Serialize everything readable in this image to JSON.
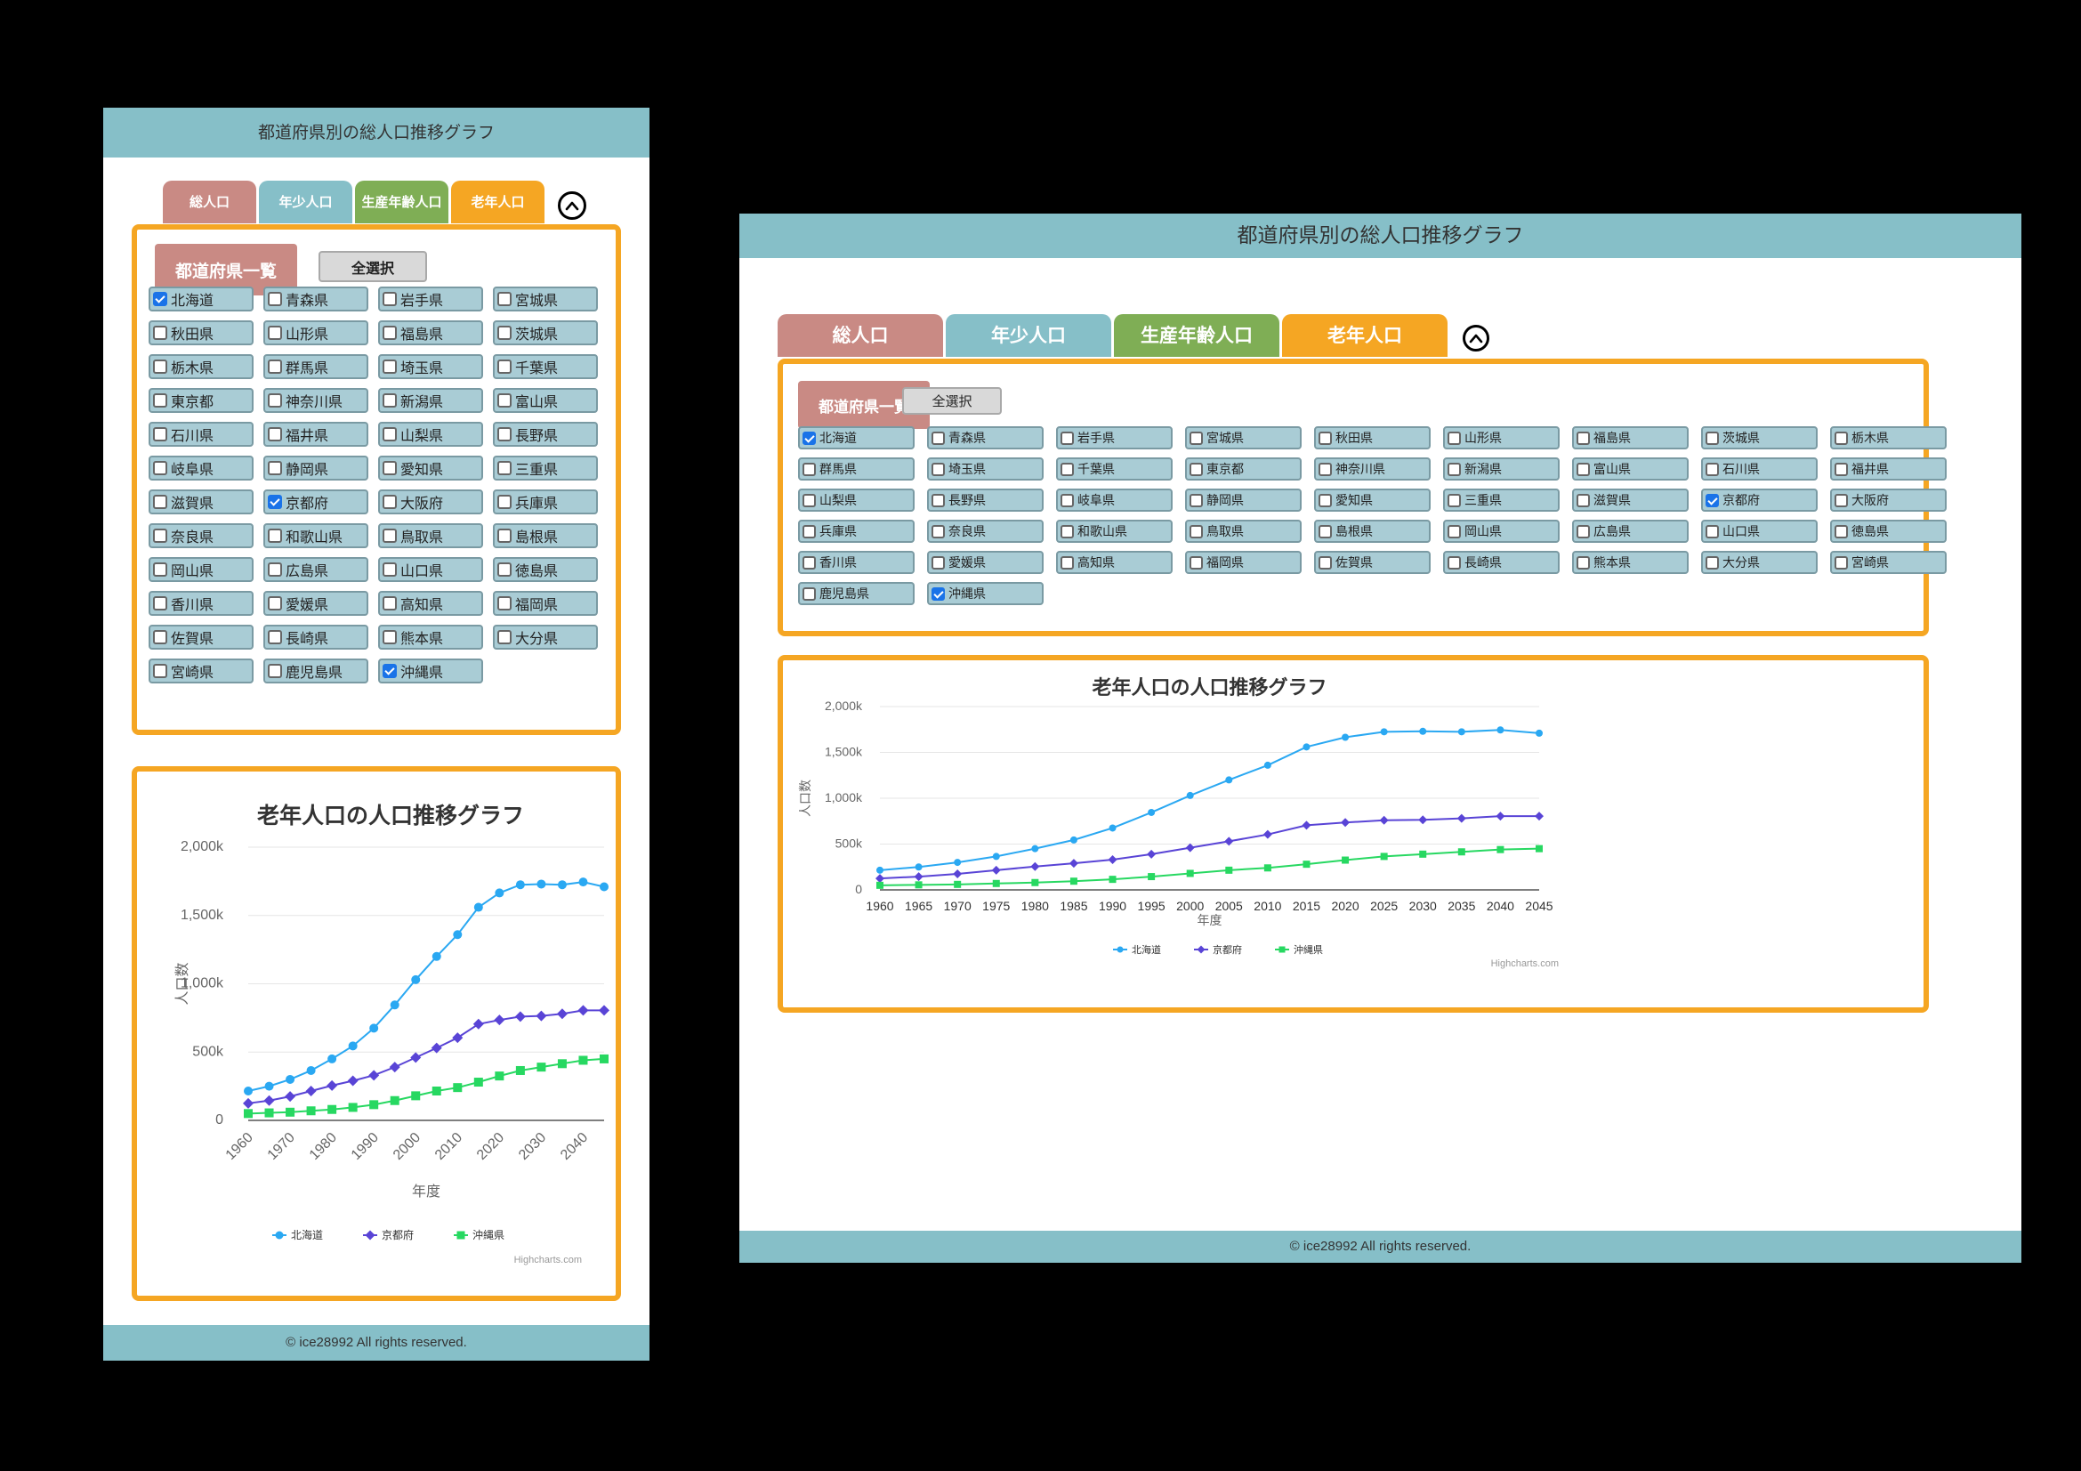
{
  "header": {
    "title": "都道府県別の総人口推移グラフ"
  },
  "tabs": [
    {
      "label": "総人口",
      "color": "#c98a84"
    },
    {
      "label": "年少人口",
      "color": "#86bfc8"
    },
    {
      "label": "生産年齢人口",
      "color": "#7fae55"
    },
    {
      "label": "老年人口",
      "color": "#f5a623"
    }
  ],
  "active_tab": "老年人口",
  "collapse_icon": "chevron-up-icon",
  "prefecture_panel": {
    "title": "都道府県一覧",
    "select_all": "全選択",
    "prefectures": [
      {
        "name": "北海道",
        "checked": true
      },
      {
        "name": "青森県",
        "checked": false
      },
      {
        "name": "岩手県",
        "checked": false
      },
      {
        "name": "宮城県",
        "checked": false
      },
      {
        "name": "秋田県",
        "checked": false
      },
      {
        "name": "山形県",
        "checked": false
      },
      {
        "name": "福島県",
        "checked": false
      },
      {
        "name": "茨城県",
        "checked": false
      },
      {
        "name": "栃木県",
        "checked": false
      },
      {
        "name": "群馬県",
        "checked": false
      },
      {
        "name": "埼玉県",
        "checked": false
      },
      {
        "name": "千葉県",
        "checked": false
      },
      {
        "name": "東京都",
        "checked": false
      },
      {
        "name": "神奈川県",
        "checked": false
      },
      {
        "name": "新潟県",
        "checked": false
      },
      {
        "name": "富山県",
        "checked": false
      },
      {
        "name": "石川県",
        "checked": false
      },
      {
        "name": "福井県",
        "checked": false
      },
      {
        "name": "山梨県",
        "checked": false
      },
      {
        "name": "長野県",
        "checked": false
      },
      {
        "name": "岐阜県",
        "checked": false
      },
      {
        "name": "静岡県",
        "checked": false
      },
      {
        "name": "愛知県",
        "checked": false
      },
      {
        "name": "三重県",
        "checked": false
      },
      {
        "name": "滋賀県",
        "checked": false
      },
      {
        "name": "京都府",
        "checked": true
      },
      {
        "name": "大阪府",
        "checked": false
      },
      {
        "name": "兵庫県",
        "checked": false
      },
      {
        "name": "奈良県",
        "checked": false
      },
      {
        "name": "和歌山県",
        "checked": false
      },
      {
        "name": "鳥取県",
        "checked": false
      },
      {
        "name": "島根県",
        "checked": false
      },
      {
        "name": "岡山県",
        "checked": false
      },
      {
        "name": "広島県",
        "checked": false
      },
      {
        "name": "山口県",
        "checked": false
      },
      {
        "name": "徳島県",
        "checked": false
      },
      {
        "name": "香川県",
        "checked": false
      },
      {
        "name": "愛媛県",
        "checked": false
      },
      {
        "name": "高知県",
        "checked": false
      },
      {
        "name": "福岡県",
        "checked": false
      },
      {
        "name": "佐賀県",
        "checked": false
      },
      {
        "name": "長崎県",
        "checked": false
      },
      {
        "name": "熊本県",
        "checked": false
      },
      {
        "name": "大分県",
        "checked": false
      },
      {
        "name": "宮崎県",
        "checked": false
      },
      {
        "name": "鹿児島県",
        "checked": false
      },
      {
        "name": "沖縄県",
        "checked": true
      }
    ]
  },
  "chart_data": {
    "type": "line",
    "title": "老年人口の人口推移グラフ",
    "xlabel": "年度",
    "ylabel": "人口数",
    "x": [
      1960,
      1965,
      1970,
      1975,
      1980,
      1985,
      1990,
      1995,
      2000,
      2005,
      2010,
      2015,
      2020,
      2025,
      2030,
      2035,
      2040,
      2045
    ],
    "mobile_x_ticks": [
      "1960",
      "1970",
      "1980",
      "1990",
      "2000",
      "2010",
      "2020",
      "2030",
      "2040"
    ],
    "ylim": [
      0,
      2000000
    ],
    "y_ticks": [
      "0",
      "500k",
      "1,000k",
      "1,500k",
      "2,000k"
    ],
    "grid": true,
    "legend_position": "bottom-center",
    "credits": "Highcharts.com",
    "series": [
      {
        "name": "北海道",
        "color": "#2aa8f2",
        "marker": "circle",
        "values": [
          215000,
          250000,
          300000,
          365000,
          450000,
          545000,
          675000,
          845000,
          1030000,
          1200000,
          1360000,
          1560000,
          1665000,
          1725000,
          1730000,
          1725000,
          1745000,
          1710000
        ]
      },
      {
        "name": "京都府",
        "color": "#5944d6",
        "marker": "diamond",
        "values": [
          125000,
          145000,
          175000,
          215000,
          255000,
          290000,
          330000,
          390000,
          460000,
          530000,
          605000,
          705000,
          735000,
          760000,
          765000,
          780000,
          805000,
          805000
        ]
      },
      {
        "name": "沖縄県",
        "color": "#27d861",
        "marker": "square",
        "values": [
          50000,
          55000,
          60000,
          70000,
          80000,
          95000,
          115000,
          145000,
          180000,
          215000,
          240000,
          280000,
          325000,
          365000,
          390000,
          415000,
          440000,
          450000
        ]
      }
    ]
  },
  "footer": {
    "text": "© ice28992 All rights reserved."
  }
}
